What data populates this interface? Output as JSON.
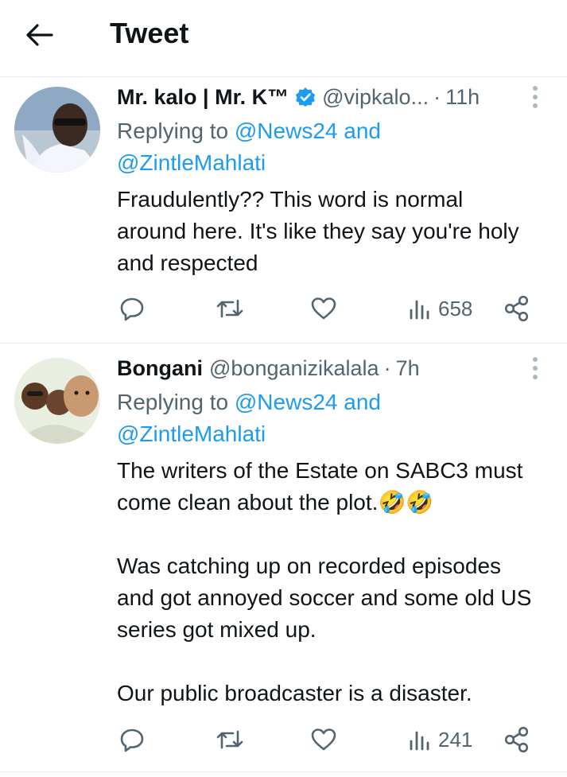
{
  "header": {
    "title": "Tweet"
  },
  "tweets": [
    {
      "author_name": "Mr. kalo | Mr. K™",
      "verified": true,
      "handle": "@vipkalo...",
      "separator": "·",
      "time": "11h",
      "replying_prefix": "Replying to",
      "replying_to_1": "@News24",
      "replying_and": "and",
      "replying_to_2": "@ZintleMahlati",
      "text": "Fraudulently?? This word is normal around here. It's like they say you're holy and respected",
      "views": "658"
    },
    {
      "author_name": "Bongani",
      "verified": false,
      "handle": "@bonganizikalala",
      "separator": "·",
      "time": "7h",
      "replying_prefix": "Replying to",
      "replying_to_1": "@News24",
      "replying_and": "and",
      "replying_to_2": "@ZintleMahlati",
      "text": "The writers of the Estate on SABC3 must come clean about the plot.🤣🤣\n\nWas catching up on recorded episodes and got annoyed soccer and some old US series got mixed up.\n\nOur public broadcaster is a disaster.",
      "views": "241"
    }
  ],
  "colors": {
    "link": "#1d9bf0",
    "secondary_text": "#536471",
    "primary_text": "#0f1419",
    "divider": "#e6ecf0"
  },
  "icons": {
    "back": "arrow-left-icon",
    "verified": "verified-badge-icon",
    "more": "more-vertical-icon",
    "reply": "reply-icon",
    "retweet": "retweet-icon",
    "like": "heart-icon",
    "views": "views-icon",
    "share": "share-icon"
  }
}
